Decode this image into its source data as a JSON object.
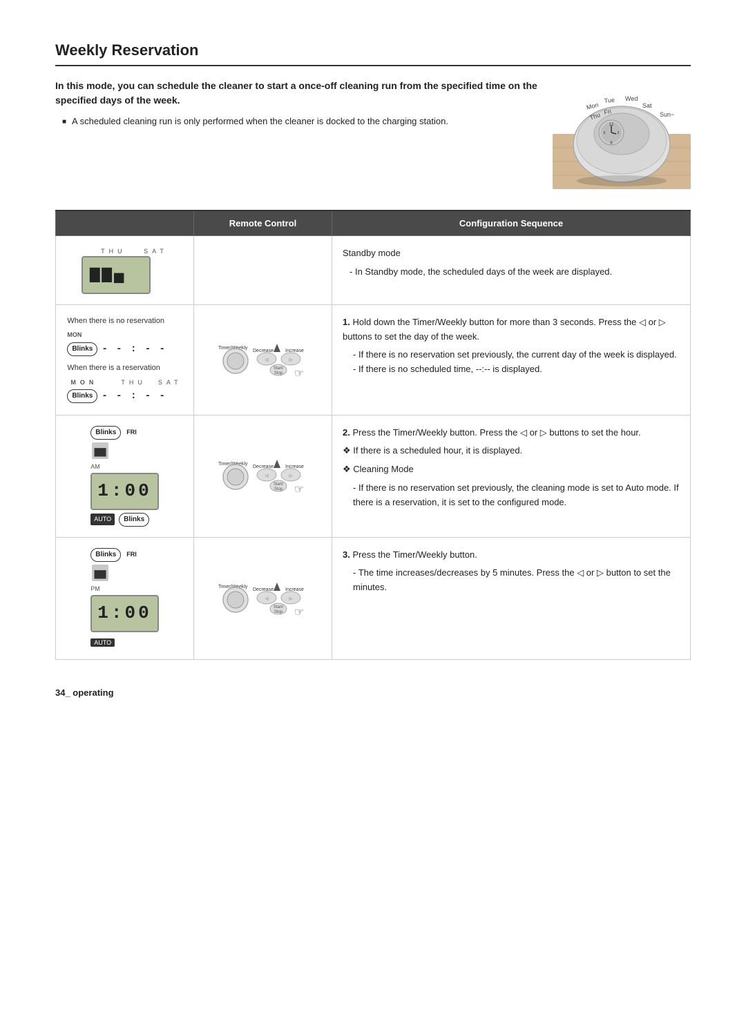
{
  "page": {
    "title": "Weekly Reservation",
    "footer": "34_ operating"
  },
  "intro": {
    "bold_text": "In this mode, you can schedule the cleaner to start a once-off cleaning run from the specified time on the specified days of the week.",
    "bullet": "A scheduled cleaning run is only performed when the cleaner is docked to the charging station."
  },
  "table": {
    "header_remote": "Remote Control",
    "header_config": "Configuration Sequence",
    "rows": [
      {
        "id": "standby",
        "config_title": "Standby mode",
        "config_items": [
          "In Standby mode, the scheduled days of the week are displayed."
        ],
        "config_type": "standby"
      },
      {
        "id": "step1",
        "step_num": "1.",
        "config_main": "Hold down the Timer/Weekly button for more than 3 seconds. Press the ◁ or ▷ buttons to set the day of the week.",
        "config_sub": [
          "If there is no reservation set previously, the current day of the week is displayed.",
          "If there is no scheduled time, --:-- is displayed."
        ],
        "config_type": "step"
      },
      {
        "id": "step2",
        "step_num": "2.",
        "config_main": "Press the Timer/Weekly button. Press the ◁ or ▷ buttons to set the hour.",
        "config_dagger": [
          "If there is a scheduled hour, it is displayed.",
          "Cleaning Mode"
        ],
        "config_sub": [
          "If there is no reservation set previously, the cleaning mode is set to Auto mode. If there is a reservation, it is set to the configured mode."
        ],
        "config_type": "step2"
      },
      {
        "id": "step3",
        "step_num": "3.",
        "config_main": "Press the Timer/Weekly button.",
        "config_sub": [
          "The time increases/decreases by 5 minutes. Press the ◁ or ▷ button to set the minutes."
        ],
        "config_type": "step"
      }
    ]
  },
  "days": {
    "mon": "MON",
    "tue": "TUE",
    "wed": "WED",
    "thu": "THU",
    "fri": "FRI",
    "sat": "SAT",
    "sun": "SUN"
  },
  "labels": {
    "blinks": "Blinks",
    "am": "AM",
    "pm": "PM",
    "auto": "AUTO",
    "timer_weekly": "Timer/Weekly",
    "decrease": "Decrease",
    "increase": "Increase",
    "start_stop": "Start/\nStop",
    "when_no_reservation": "When there is no reservation",
    "when_reservation": "When there is a reservation"
  }
}
